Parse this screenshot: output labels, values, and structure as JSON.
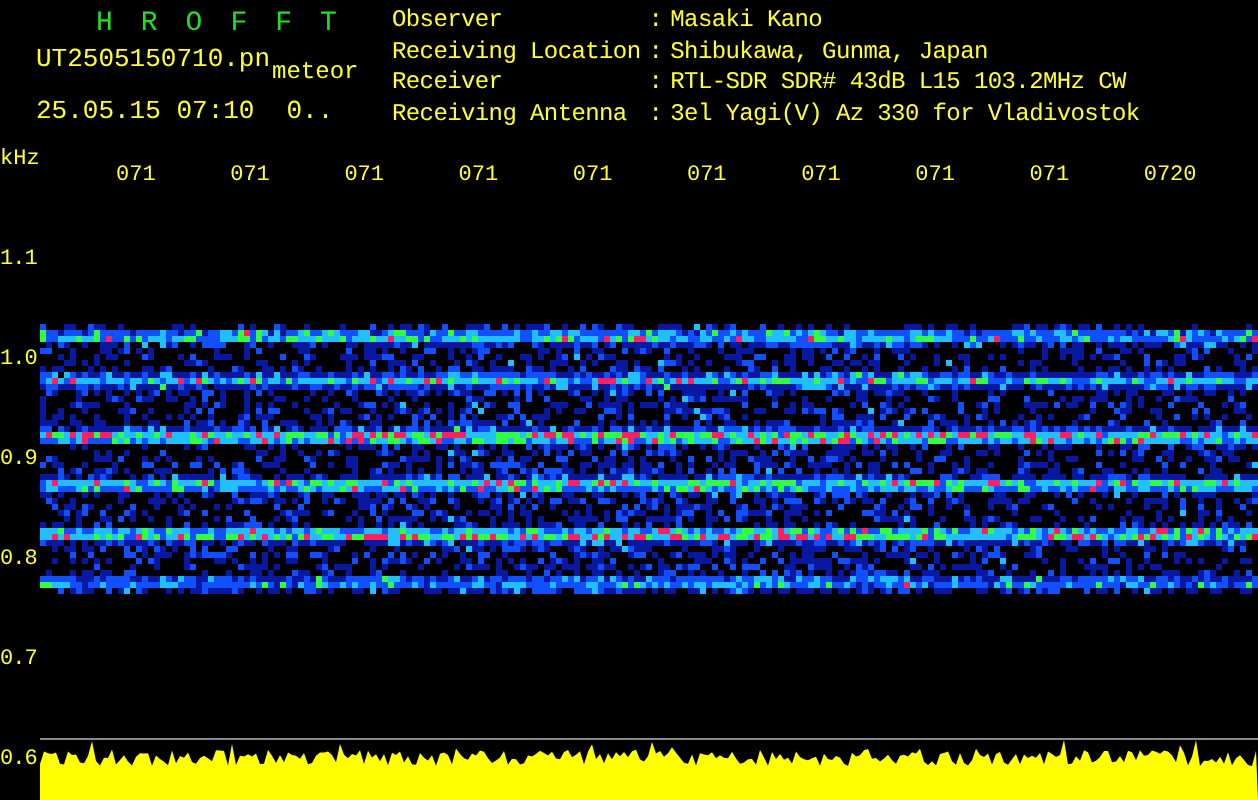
{
  "header": {
    "title": "HROFFT",
    "filename": "UT2505150710.pn",
    "tag": "meteor",
    "datetime": "25.05.15 07:10",
    "count": "0.."
  },
  "info": [
    {
      "label": "Observer",
      "separator": ":",
      "value": "Masaki Kano"
    },
    {
      "label": "Receiving Location",
      "separator": ":",
      "value": "Shibukawa, Gunma, Japan"
    },
    {
      "label": "Receiver",
      "separator": ":",
      "value": "RTL-SDR SDR# 43dB L15 103.2MHz CW"
    },
    {
      "label": "Receiving Antenna",
      "separator": ":",
      "value": "3el Yagi(V) Az 330 for Vladivostok"
    }
  ],
  "frequency_unit": "kHz",
  "time_ticks": [
    "071",
    "071",
    "071",
    "071",
    "071",
    "071",
    "071",
    "071",
    "071",
    "0720"
  ],
  "frequency_labels": [
    "1.1",
    "1.0",
    "0.9",
    "0.8",
    "0.7",
    "0.6"
  ]
}
